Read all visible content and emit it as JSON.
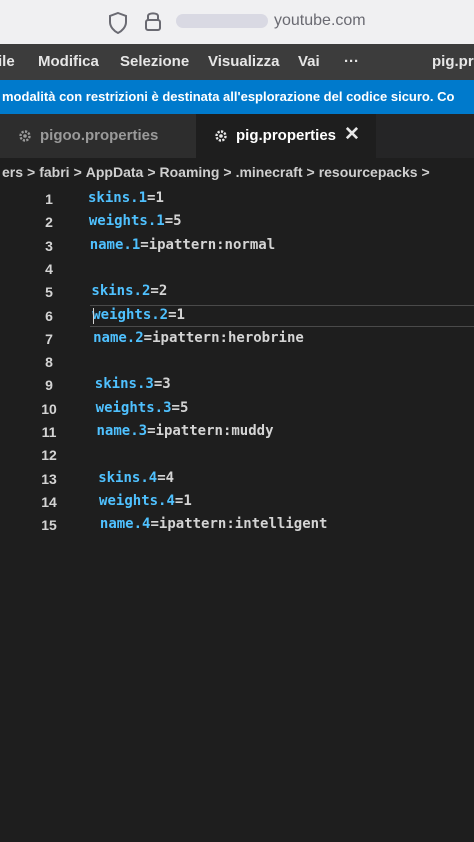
{
  "browser": {
    "url": "youtube.com"
  },
  "menu": {
    "items": [
      "ile",
      "Modifica",
      "Selezione",
      "Visualizza",
      "Vai",
      "···",
      "pig.pro"
    ]
  },
  "banner": {
    "text": "modalità con restrizioni è destinata all'esplorazione del codice sicuro. Co"
  },
  "tabs": [
    {
      "label": "pigoo.properties",
      "active": false
    },
    {
      "label": "pig.properties",
      "active": true,
      "close": "✕"
    }
  ],
  "breadcrumb": {
    "items": [
      "ers",
      "fabri",
      "AppData",
      "Roaming",
      ".minecraft",
      "resourcepacks"
    ],
    "separator": ">"
  },
  "editor": {
    "current_line": 6,
    "lines": [
      {
        "number": "1",
        "key": "skins.1",
        "value": "1"
      },
      {
        "number": "2",
        "key": "weights.1",
        "value": "5"
      },
      {
        "number": "3",
        "key": "name.1",
        "value": "ipattern:normal"
      },
      {
        "number": "4",
        "key": "",
        "value": ""
      },
      {
        "number": "5",
        "key": "skins.2",
        "value": "2"
      },
      {
        "number": "6",
        "key": "weights.2",
        "value": "1"
      },
      {
        "number": "7",
        "key": "name.2",
        "value": "ipattern:herobrine"
      },
      {
        "number": "8",
        "key": "",
        "value": ""
      },
      {
        "number": "9",
        "key": "skins.3",
        "value": "3"
      },
      {
        "number": "10",
        "key": "weights.3",
        "value": "5"
      },
      {
        "number": "11",
        "key": "name.3",
        "value": "ipattern:muddy"
      },
      {
        "number": "12",
        "key": "",
        "value": ""
      },
      {
        "number": "13",
        "key": "skins.4",
        "value": "4"
      },
      {
        "number": "14",
        "key": "weights.4",
        "value": "1"
      },
      {
        "number": "15",
        "key": "name.4",
        "value": "ipattern:intelligent"
      }
    ]
  },
  "colors": {
    "banner": "#007acc",
    "key": "#4fc1ff",
    "text": "#d4d4d4",
    "editor_bg": "#1e1e1e"
  },
  "icons": {
    "browser": [
      "shield-icon",
      "lock-icon"
    ],
    "tabs": [
      "gear-icon"
    ],
    "tab_close": "close-icon"
  }
}
